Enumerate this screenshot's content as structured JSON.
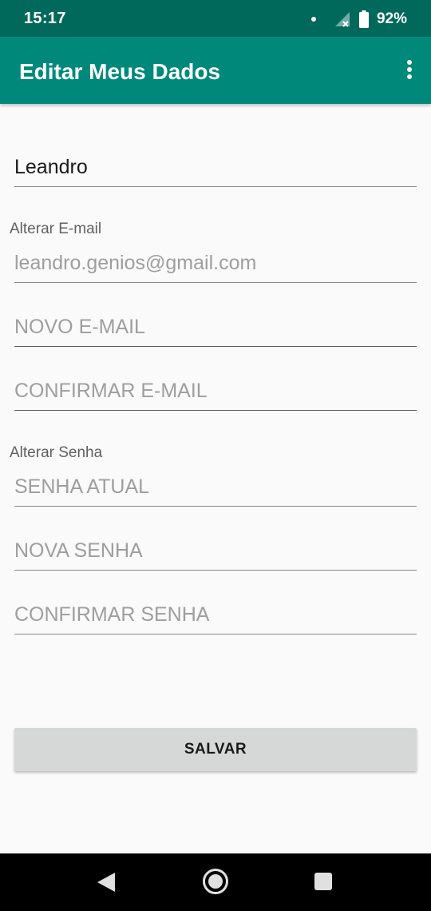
{
  "status_bar": {
    "time": "15:17",
    "battery": "92%",
    "icons": [
      "notification-dot-icon",
      "signal-icon",
      "battery-icon"
    ]
  },
  "app_bar": {
    "title": "Editar Meus Dados",
    "menu_icon": "more-vert-icon"
  },
  "form": {
    "name_value": "Leandro",
    "email_section_label": "Alterar E-mail",
    "current_email_placeholder": "leandro.genios@gmail.com",
    "new_email_placeholder": "NOVO E-MAIL",
    "confirm_email_placeholder": "CONFIRMAR E-MAIL",
    "password_section_label": "Alterar Senha",
    "current_password_placeholder": "SENHA ATUAL",
    "new_password_placeholder": "NOVA SENHA",
    "confirm_password_placeholder": "CONFIRMAR SENHA",
    "save_label": "SALVAR"
  },
  "nav_bar": {
    "icons": [
      "back-icon",
      "home-icon",
      "recent-apps-icon"
    ]
  },
  "colors": {
    "status_bar": "#00695c",
    "app_bar": "#00897b",
    "background": "#fafafa",
    "button": "#d6d7d7"
  }
}
